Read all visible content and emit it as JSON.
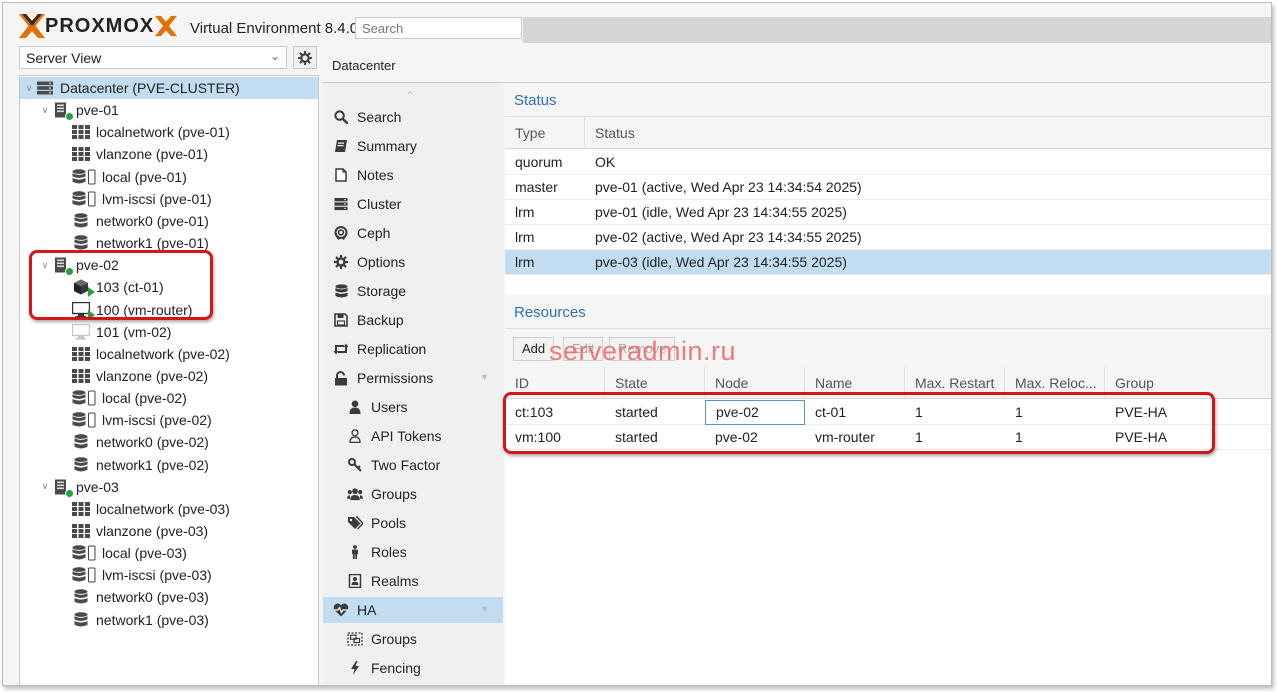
{
  "app": {
    "logo_text": "PROXMOX",
    "version": "Virtual Environment 8.4.0",
    "search_placeholder": "Search",
    "watermark": "serveradmin.ru"
  },
  "left": {
    "view_select": "Server View",
    "tree": [
      {
        "label": "Datacenter (PVE-CLUSTER)",
        "icon": "datacenter-icon",
        "level": 0,
        "expander": "chevron-down",
        "selected": true
      },
      {
        "label": "pve-01",
        "icon": "node-online-icon",
        "level": 1,
        "expander": "chevron-down"
      },
      {
        "label": "localnetwork (pve-01)",
        "icon": "network-grid-icon",
        "level": 2
      },
      {
        "label": "vlanzone (pve-01)",
        "icon": "network-grid-icon",
        "level": 2
      },
      {
        "label": "local (pve-01)",
        "icon": "storage-file-icon",
        "level": 2
      },
      {
        "label": "lvm-iscsi (pve-01)",
        "icon": "storage-file-icon",
        "level": 2
      },
      {
        "label": "network0 (pve-01)",
        "icon": "storage-icon",
        "level": 2
      },
      {
        "label": "network1 (pve-01)",
        "icon": "storage-icon",
        "level": 2
      },
      {
        "label": "pve-02",
        "icon": "node-online-icon",
        "level": 1,
        "expander": "chevron-down"
      },
      {
        "label": "103 (ct-01)",
        "icon": "container-running-icon",
        "level": 2
      },
      {
        "label": "100 (vm-router)",
        "icon": "vm-running-icon",
        "level": 2
      },
      {
        "label": "101 (vm-02)",
        "icon": "vm-stopped-icon",
        "level": 2
      },
      {
        "label": "localnetwork (pve-02)",
        "icon": "network-grid-icon",
        "level": 2
      },
      {
        "label": "vlanzone (pve-02)",
        "icon": "network-grid-icon",
        "level": 2
      },
      {
        "label": "local (pve-02)",
        "icon": "storage-file-icon",
        "level": 2
      },
      {
        "label": "lvm-iscsi (pve-02)",
        "icon": "storage-file-icon",
        "level": 2
      },
      {
        "label": "network0 (pve-02)",
        "icon": "storage-icon",
        "level": 2
      },
      {
        "label": "network1 (pve-02)",
        "icon": "storage-icon",
        "level": 2
      },
      {
        "label": "pve-03",
        "icon": "node-online-icon",
        "level": 1,
        "expander": "chevron-down"
      },
      {
        "label": "localnetwork (pve-03)",
        "icon": "network-grid-icon",
        "level": 2
      },
      {
        "label": "vlanzone (pve-03)",
        "icon": "network-grid-icon",
        "level": 2
      },
      {
        "label": "local (pve-03)",
        "icon": "storage-file-icon",
        "level": 2
      },
      {
        "label": "lvm-iscsi (pve-03)",
        "icon": "storage-file-icon",
        "level": 2
      },
      {
        "label": "network0 (pve-03)",
        "icon": "storage-icon",
        "level": 2
      },
      {
        "label": "network1 (pve-03)",
        "icon": "storage-icon",
        "level": 2
      }
    ]
  },
  "breadcrumb": "Datacenter",
  "nav": [
    {
      "label": "Search",
      "icon": "search-icon",
      "sub": false
    },
    {
      "label": "Summary",
      "icon": "book-icon",
      "sub": false
    },
    {
      "label": "Notes",
      "icon": "notes-icon",
      "sub": false
    },
    {
      "label": "Cluster",
      "icon": "server-icon",
      "sub": false
    },
    {
      "label": "Ceph",
      "icon": "ceph-icon",
      "sub": false
    },
    {
      "label": "Options",
      "icon": "gear-icon",
      "sub": false
    },
    {
      "label": "Storage",
      "icon": "database-icon",
      "sub": false
    },
    {
      "label": "Backup",
      "icon": "floppy-icon",
      "sub": false
    },
    {
      "label": "Replication",
      "icon": "retweet-icon",
      "sub": false
    },
    {
      "label": "Permissions",
      "icon": "unlock-icon",
      "sub": false,
      "chevron": true
    },
    {
      "label": "Users",
      "icon": "user-icon",
      "sub": true
    },
    {
      "label": "API Tokens",
      "icon": "user-outline-icon",
      "sub": true
    },
    {
      "label": "Two Factor",
      "icon": "key-icon",
      "sub": true
    },
    {
      "label": "Groups",
      "icon": "users-icon",
      "sub": true
    },
    {
      "label": "Pools",
      "icon": "tags-icon",
      "sub": true
    },
    {
      "label": "Roles",
      "icon": "male-icon",
      "sub": true
    },
    {
      "label": "Realms",
      "icon": "address-book-icon",
      "sub": true
    },
    {
      "label": "HA",
      "icon": "heartbeat-icon",
      "sub": false,
      "chevron": true,
      "selected": true
    },
    {
      "label": "Groups",
      "icon": "object-group-icon",
      "sub": true
    },
    {
      "label": "Fencing",
      "icon": "bolt-icon",
      "sub": true
    }
  ],
  "status": {
    "title": "Status",
    "columns": [
      "Type",
      "Status"
    ],
    "rows": [
      {
        "type": "quorum",
        "status": "OK"
      },
      {
        "type": "master",
        "status": "pve-01 (active, Wed Apr 23 14:34:54 2025)"
      },
      {
        "type": "lrm",
        "status": "pve-01 (idle, Wed Apr 23 14:34:55 2025)"
      },
      {
        "type": "lrm",
        "status": "pve-02 (active, Wed Apr 23 14:34:55 2025)"
      },
      {
        "type": "lrm",
        "status": "pve-03 (idle, Wed Apr 23 14:34:55 2025)",
        "selected": true
      }
    ]
  },
  "resources": {
    "title": "Resources",
    "buttons": {
      "add": "Add",
      "edit": "Edit",
      "remove": "Remove"
    },
    "columns": [
      "ID",
      "State",
      "Node",
      "Name",
      "Max. Restart",
      "Max. Reloc...",
      "Group"
    ],
    "rows": [
      [
        "ct:103",
        "started",
        "pve-02",
        "ct-01",
        "1",
        "1",
        "PVE-HA"
      ],
      [
        "vm:100",
        "started",
        "pve-02",
        "vm-router",
        "1",
        "1",
        "PVE-HA"
      ]
    ]
  },
  "colors": {
    "accent": "#3073b4",
    "selection": "#c2ddf2",
    "logo_orange": "#e57000",
    "highlight_red": "#d7141a",
    "status_green": "#21a33a"
  }
}
